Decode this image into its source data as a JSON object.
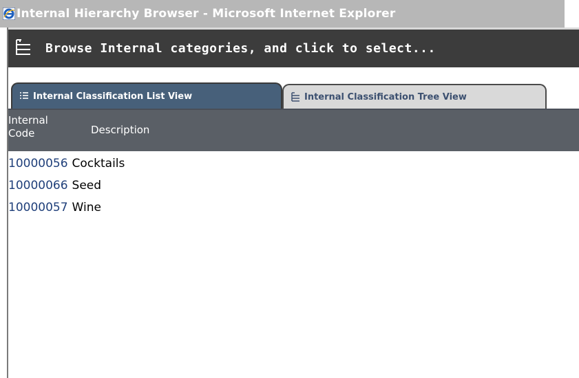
{
  "window": {
    "title": "Internal Hierarchy Browser - Microsoft Internet Explorer",
    "icon": "ie-icon"
  },
  "header": {
    "icon": "tree-icon",
    "text": "Browse Internal categories, and click to select..."
  },
  "tabs": [
    {
      "label": "Internal Classification List View",
      "icon": "list-icon",
      "active": true
    },
    {
      "label": "Internal Classification Tree View",
      "icon": "tree-icon",
      "active": false
    }
  ],
  "table": {
    "headers": {
      "code_line1": "Internal",
      "code_line2": "Code",
      "description": "Description"
    },
    "rows": [
      {
        "code": "10000056",
        "description": "Cocktails"
      },
      {
        "code": "10000066",
        "description": "Seed"
      },
      {
        "code": "10000057",
        "description": "Wine"
      }
    ]
  },
  "colors": {
    "header_bg": "#3c3c3c",
    "active_tab": "#47607a",
    "inactive_tab": "#d9d9d9",
    "column_header": "#5a5f66",
    "link": "#1f3f7a"
  }
}
